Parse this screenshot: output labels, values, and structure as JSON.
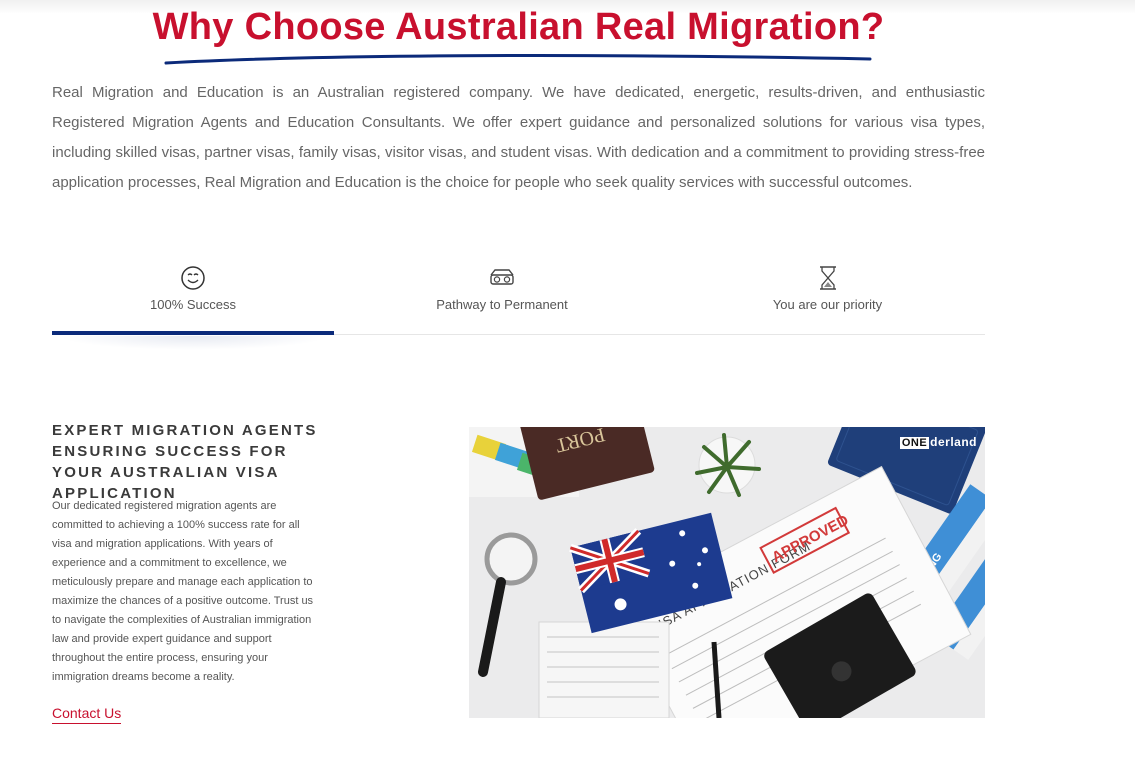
{
  "section": {
    "title": "Why Choose Australian Real Migration?",
    "intro": "Real Migration and Education is an Australian registered company. We have dedicated, energetic, results-driven, and enthusiastic Registered Migration Agents and Education Consultants. We offer expert guidance and personalized solutions for various visa types, including skilled visas, partner visas, family visas, visitor visas, and student visas. With dedication and a commitment to providing stress-free application processes, Real Migration and Education is the choice for people who seek quality services with successful outcomes.",
    "accent_color": "#c8102e",
    "tab_indicator_color": "#0b2a7a"
  },
  "tabs": [
    {
      "label": "100% Success",
      "icon": "smiley-face-icon",
      "active": true
    },
    {
      "label": "Pathway to Permanent",
      "icon": "vr-glasses-icon",
      "active": false
    },
    {
      "label": "You are our priority",
      "icon": "hourglass-icon",
      "active": false
    }
  ],
  "panel": {
    "heading": "Expert Migration Agents Ensuring Success for Your Australian Visa Application",
    "body": "Our dedicated registered migration agents are committed to achieving a 100% success rate for all visa and migration applications. With years of experience and a commitment to excellence, we meticulously prepare and manage each application to maximize the chances of a positive outcome. Trust us to navigate the complexities of Australian immigration law and provide expert guidance and support throughout the entire process, ensuring your immigration dreams become a reality.",
    "cta": "Contact Us"
  },
  "image": {
    "brand_box": "ONE",
    "brand_rest": "derland",
    "form_title": "VISA APPLICATION FORM",
    "stamp": "APPROVED",
    "passport_text": "PORT",
    "boarding_text": "BOARDING"
  }
}
